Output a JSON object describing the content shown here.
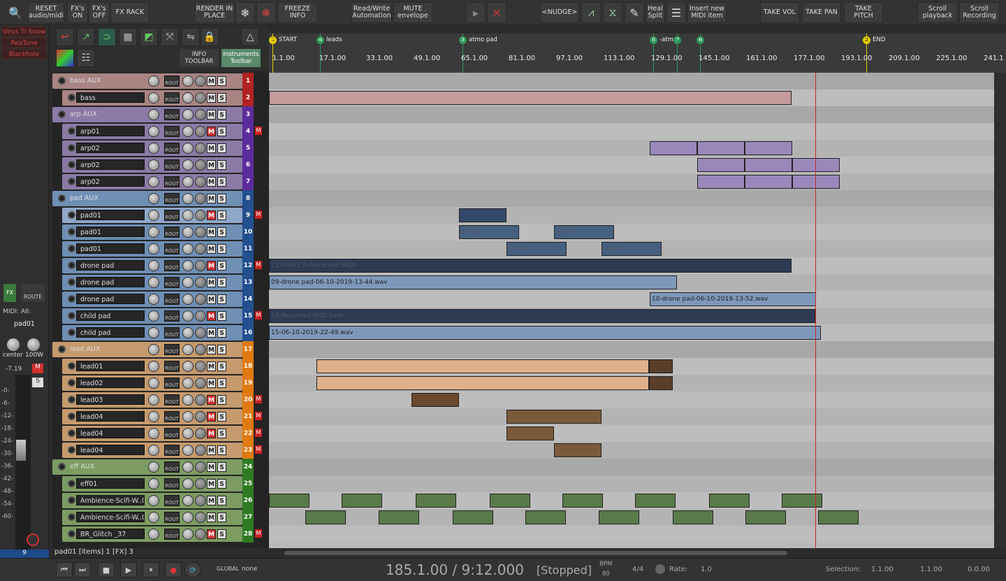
{
  "toolbar": {
    "reset": "RESET\naudio/midi",
    "fx_on": "FX's\nON",
    "fx_off": "FX's\nOFF",
    "fx_rack": "FX RACK",
    "render": "RENDER IN\nPLACE",
    "freeze": "FREEZE\nINFO",
    "rw_auto": "Read/Write\nAutomation",
    "mute_env": "MUTE\nenvelope",
    "nudge": "<NUDGE>",
    "heal": "Heal\nSplit",
    "insert_midi": "Insert new\nMIDI item",
    "take_vol": "TAKE VOL",
    "take_pan": "TAKE PAN",
    "take_pitch": "TAKE\nPITCH",
    "scroll_play": "Scroll\nplayback",
    "scroll_rec": "Scroll\nRecording"
  },
  "secondary": {
    "info_toolbar": "INFO\nTOOLBAR",
    "instruments_toolbar": "Instruments\nToolbar"
  },
  "plugins": [
    "Virus TI Snow",
    "ReaTune",
    "Blackhole"
  ],
  "master": {
    "fx": "FX",
    "route": "ROUTE",
    "midi": "MIDI: All:",
    "track_name": "pad01",
    "pan": "center",
    "width": "100W",
    "peak": "-7.19",
    "scale": [
      "-0-",
      "-6-",
      "-12-",
      "-18-",
      "-24-",
      "-30-",
      "-36-",
      "-42-",
      "-48-",
      "-54-",
      "-60-"
    ],
    "track_num": "9"
  },
  "ruler": {
    "ticks": [
      "1.1.00",
      "17.1.00",
      "33.1.00",
      "49.1.00",
      "65.1.00",
      "81.1.00",
      "97.1.00",
      "113.1.00",
      "129.1.00",
      "145.1.00",
      "161.1.00",
      "177.1.00",
      "193.1.00",
      "209.1.00",
      "225.1.00",
      "241.1"
    ],
    "markers": [
      {
        "id": "1",
        "label": "START",
        "color": "#e8d000"
      },
      {
        "id": "4",
        "label": "leads",
        "color": "#2e9a5a"
      },
      {
        "id": "3",
        "label": "atmo pad",
        "color": "#2e9a5a"
      },
      {
        "id": "5",
        "label": "-atm",
        "color": "#2e9a5a"
      },
      {
        "id": "7",
        "label": "",
        "color": "#2e9a5a"
      },
      {
        "id": "6",
        "label": "",
        "color": "#2e9a5a"
      },
      {
        "id": "2",
        "label": "END",
        "color": "#e8d000"
      }
    ]
  },
  "tracks": [
    {
      "name": "bass AUX",
      "num": "1",
      "folder": true,
      "color": "#a98482",
      "numcolor": "#b22222",
      "m": false,
      "flag": false
    },
    {
      "name": "bass",
      "num": "2",
      "folder": false,
      "color": "#a98482",
      "numcolor": "#b22222",
      "m": false,
      "flag": false
    },
    {
      "name": "arp AUX",
      "num": "3",
      "folder": true,
      "color": "#8b7aa6",
      "numcolor": "#5c2b9c",
      "m": false,
      "flag": false
    },
    {
      "name": "arp01",
      "num": "4",
      "folder": false,
      "color": "#8b7aa6",
      "numcolor": "#5c2b9c",
      "m": true,
      "flag": true
    },
    {
      "name": "arp02",
      "num": "5",
      "folder": false,
      "color": "#8b7aa6",
      "numcolor": "#5c2b9c",
      "m": false,
      "flag": false
    },
    {
      "name": "arp02",
      "num": "6",
      "folder": false,
      "color": "#8b7aa6",
      "numcolor": "#5c2b9c",
      "m": false,
      "flag": false
    },
    {
      "name": "arp02",
      "num": "7",
      "folder": false,
      "color": "#8b7aa6",
      "numcolor": "#5c2b9c",
      "m": false,
      "flag": false
    },
    {
      "name": "pad AUX",
      "num": "8",
      "folder": true,
      "color": "#6f8fb5",
      "numcolor": "#234f8f",
      "m": false,
      "flag": false
    },
    {
      "name": "pad01",
      "num": "9",
      "folder": false,
      "color": "#8fa7c8",
      "numcolor": "#234f8f",
      "m": true,
      "flag": true
    },
    {
      "name": "pad01",
      "num": "10",
      "folder": false,
      "color": "#6f8fb5",
      "numcolor": "#234f8f",
      "m": false,
      "flag": false
    },
    {
      "name": "pad01",
      "num": "11",
      "folder": false,
      "color": "#6f8fb5",
      "numcolor": "#234f8f",
      "m": false,
      "flag": false
    },
    {
      "name": "drone pad",
      "num": "12",
      "folder": false,
      "color": "#6f8fb5",
      "numcolor": "#234f8f",
      "m": true,
      "flag": true
    },
    {
      "name": "drone pad",
      "num": "13",
      "folder": false,
      "color": "#6f8fb5",
      "numcolor": "#234f8f",
      "m": false,
      "flag": false
    },
    {
      "name": "drone pad",
      "num": "14",
      "folder": false,
      "color": "#6f8fb5",
      "numcolor": "#234f8f",
      "m": false,
      "flag": false
    },
    {
      "name": "child pad",
      "num": "15",
      "folder": false,
      "color": "#6f8fb5",
      "numcolor": "#234f8f",
      "m": true,
      "flag": true
    },
    {
      "name": "child pad",
      "num": "16",
      "folder": false,
      "color": "#6f8fb5",
      "numcolor": "#234f8f",
      "m": false,
      "flag": false
    },
    {
      "name": "lead AUX",
      "num": "17",
      "folder": true,
      "color": "#c59a6d",
      "numcolor": "#e07a10",
      "m": false,
      "flag": false
    },
    {
      "name": "lead01",
      "num": "18",
      "folder": false,
      "color": "#c59a6d",
      "numcolor": "#e07a10",
      "m": false,
      "flag": false
    },
    {
      "name": "lead02",
      "num": "19",
      "folder": false,
      "color": "#c59a6d",
      "numcolor": "#e07a10",
      "m": false,
      "flag": false
    },
    {
      "name": "lead03",
      "num": "20",
      "folder": false,
      "color": "#c59a6d",
      "numcolor": "#e07a10",
      "m": true,
      "flag": true
    },
    {
      "name": "lead04",
      "num": "21",
      "folder": false,
      "color": "#c59a6d",
      "numcolor": "#e07a10",
      "m": true,
      "flag": true
    },
    {
      "name": "lead04",
      "num": "22",
      "folder": false,
      "color": "#c59a6d",
      "numcolor": "#e07a10",
      "m": true,
      "flag": true
    },
    {
      "name": "lead04",
      "num": "23",
      "folder": false,
      "color": "#c59a6d",
      "numcolor": "#e07a10",
      "m": false,
      "flag": true
    },
    {
      "name": "eff AUX",
      "num": "24",
      "folder": true,
      "color": "#7c9c62",
      "numcolor": "#2e7a22",
      "m": false,
      "flag": false
    },
    {
      "name": "eff01",
      "num": "25",
      "folder": false,
      "color": "#7c9c62",
      "numcolor": "#2e7a22",
      "m": false,
      "flag": false
    },
    {
      "name": "Ambience-Scifi-W..03",
      "num": "26",
      "folder": false,
      "color": "#7c9c62",
      "numcolor": "#2e7a22",
      "m": false,
      "flag": false
    },
    {
      "name": "Ambience-Scifi-W..03",
      "num": "27",
      "folder": false,
      "color": "#7c9c62",
      "numcolor": "#2e7a22",
      "m": false,
      "flag": false
    },
    {
      "name": "BR_Glitch _37",
      "num": "28",
      "folder": false,
      "color": "#7c9c62",
      "numcolor": "#2e7a22",
      "m": true,
      "flag": true
    }
  ],
  "items": {
    "drone_midi": "12-VIRUS TI-Recorded MIDI",
    "drone_wav1": "09-drone pad-06-10-2019-13-44.wav",
    "drone_wav2": "10-drone pad-06-10-2019-13-52.wav",
    "child_midi": "14-Recorded MIDI item",
    "child_wav": "15-06-10-2019-22-49.wav",
    "pad_vii": "16-VII"
  },
  "status": {
    "line": "pad01 [items] 1 [FX] 3"
  },
  "transport": {
    "position": "185.1.00 / 9:12.000",
    "state": "[Stopped]",
    "bpm_label": "BPM",
    "bpm": "80",
    "timesig": "4/4",
    "rate_label": "Rate:",
    "rate": "1.0",
    "global": "GLOBAL",
    "none": "none",
    "selection_label": "Selection:",
    "sel_start": "1.1.00",
    "sel_end": "1.1.00",
    "sel_len": "0.0.00"
  }
}
